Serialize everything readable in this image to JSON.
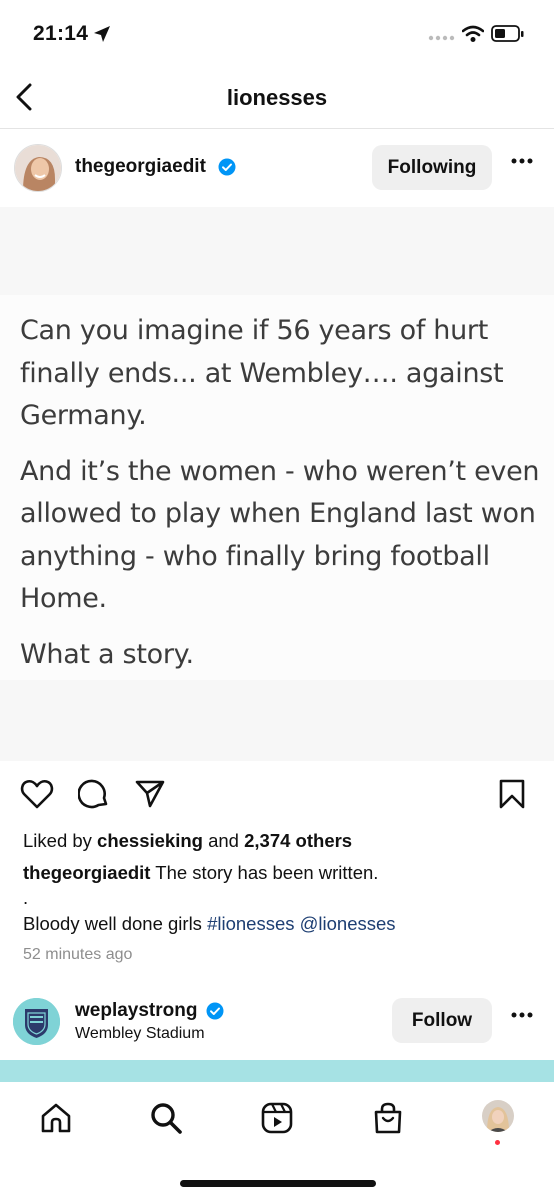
{
  "status": {
    "time": "21:14"
  },
  "header": {
    "title": "lionesses"
  },
  "post": {
    "username": "thegeorgiaedit",
    "follow_state": "Following",
    "quote": {
      "p1": "Can you imagine if 56 years of hurt finally ends... at Wembley…. against Germany.",
      "p2": "And it’s the women - who weren’t even allowed to play when England last won anything - who finally bring football Home.",
      "p3": "What a story."
    },
    "likes": {
      "prefix": "Liked by",
      "user": "chessieking",
      "middle": "and",
      "count": "2,374 others"
    },
    "caption": {
      "username": "thegeorgiaedit",
      "text": "The story has been written.",
      "dot": ".",
      "line2": "Bloody well done girls",
      "hashtag": "#lionesses",
      "mention": "@lionesses"
    },
    "timestamp": "52 minutes ago"
  },
  "next_post": {
    "username": "weplaystrong",
    "location": "Wembley Stadium",
    "follow_label": "Follow"
  },
  "tabs": [
    "home-icon",
    "search-icon",
    "reels-icon",
    "shop-icon",
    "profile-avatar"
  ],
  "colors": {
    "verified": "#0095f6",
    "link": "#1d3e72",
    "button_bg": "#efefef",
    "strip": "#a6e2e4"
  }
}
